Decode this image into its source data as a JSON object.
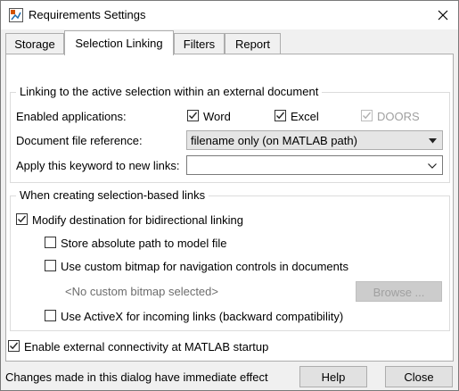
{
  "window": {
    "title": "Requirements Settings"
  },
  "tabs": [
    {
      "label": "Storage"
    },
    {
      "label": "Selection Linking"
    },
    {
      "label": "Filters"
    },
    {
      "label": "Report"
    }
  ],
  "linking_group": {
    "title": "Linking to the active selection within an external document",
    "enabled_apps_label": "Enabled applications:",
    "apps": [
      {
        "label": "Word",
        "checked": true
      },
      {
        "label": "Excel",
        "checked": true
      },
      {
        "label": "DOORS",
        "checked": true,
        "disabled": true
      }
    ],
    "doc_ref_label": "Document file reference:",
    "doc_ref_value": "filename only (on MATLAB path)",
    "keyword_label": "Apply this keyword to new links:",
    "keyword_value": ""
  },
  "selection_group": {
    "title": "When creating selection-based links",
    "modify_destination": {
      "label": "Modify destination for bidirectional linking",
      "checked": true
    },
    "store_absolute": {
      "label": "Store absolute path to model file",
      "checked": false
    },
    "custom_bitmap": {
      "label": "Use custom bitmap for navigation controls in documents",
      "checked": false
    },
    "bitmap_placeholder": "<No custom bitmap selected>",
    "browse_label": "Browse ...",
    "activex": {
      "label": "Use ActiveX for incoming links (backward compatibility)",
      "checked": false
    }
  },
  "external_connectivity": {
    "label": "Enable external connectivity at MATLAB startup",
    "checked": true
  },
  "footer": {
    "status": "Changes made in this dialog have immediate effect",
    "help_label": "Help",
    "close_label": "Close"
  }
}
